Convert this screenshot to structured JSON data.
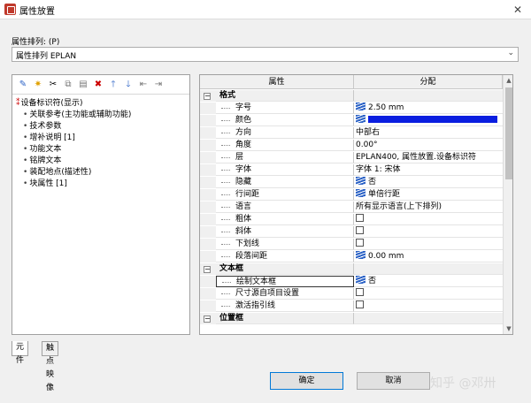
{
  "window": {
    "title": "属性放置"
  },
  "sort": {
    "label": "属性排列: (P)",
    "selected": "属性排列 EPLAN"
  },
  "toolbar": [
    {
      "name": "edit-icon",
      "glyph": "✎"
    },
    {
      "name": "new-icon",
      "glyph": "✷"
    },
    {
      "name": "cut-icon",
      "glyph": "✂"
    },
    {
      "name": "copy-icon",
      "glyph": "⧉"
    },
    {
      "name": "paste-icon",
      "glyph": "▤"
    },
    {
      "name": "delete-icon",
      "glyph": "✖"
    },
    {
      "name": "move-up-icon",
      "glyph": "🡑"
    },
    {
      "name": "move-down-icon",
      "glyph": "🡓"
    },
    {
      "name": "collapse-icon",
      "glyph": "⇤"
    },
    {
      "name": "expand-icon",
      "glyph": "⇥"
    }
  ],
  "tree": {
    "root": "设备标识符(显示)",
    "items": [
      "关联参考(主功能或辅助功能)",
      "技术参数",
      "增补说明 [1]",
      "功能文本",
      "铭牌文本",
      "装配地点(描述性)",
      "块属性 [1]"
    ]
  },
  "tabs": [
    "元件",
    "触点映像"
  ],
  "grid": {
    "headers": [
      "属性",
      "分配"
    ],
    "rows": [
      {
        "type": "cat",
        "name": "格式"
      },
      {
        "type": "prop",
        "name": "字号",
        "icon": true,
        "value": "2.50 mm"
      },
      {
        "type": "prop",
        "name": "颜色",
        "icon": true,
        "color": "#0a1ee0"
      },
      {
        "type": "prop",
        "name": "方向",
        "value": "中部右"
      },
      {
        "type": "prop",
        "name": "角度",
        "value": "0.00°"
      },
      {
        "type": "prop",
        "name": "层",
        "value": "EPLAN400, 属性放置.设备标识符"
      },
      {
        "type": "prop",
        "name": "字体",
        "value": "字体 1: 宋体"
      },
      {
        "type": "prop",
        "name": "隐藏",
        "icon": true,
        "value": "否"
      },
      {
        "type": "prop",
        "name": "行间距",
        "icon": true,
        "value": "单倍行距"
      },
      {
        "type": "prop",
        "name": "语言",
        "value": "所有显示语言(上下排列)"
      },
      {
        "type": "prop",
        "name": "粗体",
        "check": true
      },
      {
        "type": "prop",
        "name": "斜体",
        "check": true
      },
      {
        "type": "prop",
        "name": "下划线",
        "check": true
      },
      {
        "type": "prop",
        "name": "段落间距",
        "icon": true,
        "value": "0.00 mm"
      },
      {
        "type": "cat",
        "name": "文本框"
      },
      {
        "type": "prop",
        "name": "绘制文本框",
        "icon": true,
        "value": "否",
        "selected": true
      },
      {
        "type": "prop",
        "name": "尺寸源自项目设置",
        "check": true
      },
      {
        "type": "prop",
        "name": "激活指引线",
        "check": true
      },
      {
        "type": "cat",
        "name": "位置框"
      }
    ]
  },
  "buttons": {
    "ok": "确定",
    "cancel": "取消"
  },
  "watermark": "知乎 @邓卅"
}
